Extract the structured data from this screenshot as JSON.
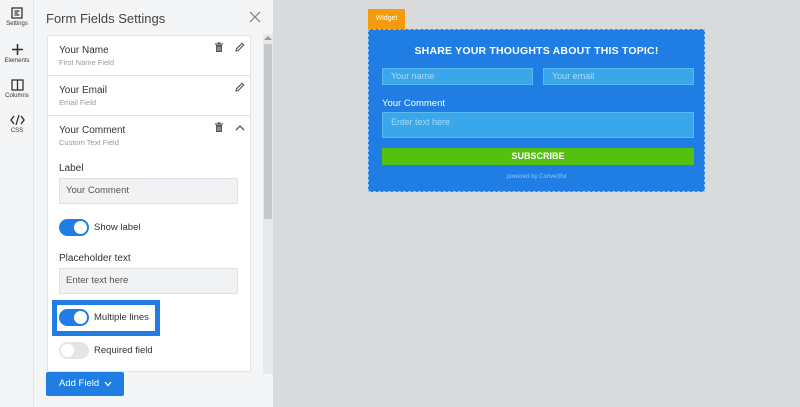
{
  "rail": {
    "settings_label": "Settings",
    "elements_label": "Elements",
    "columns_label": "Columns",
    "css_label": "CSS"
  },
  "panel": {
    "title": "Form Fields Settings",
    "fields": [
      {
        "name": "Your Name",
        "type": "First Name Field"
      },
      {
        "name": "Your Email",
        "type": "Email Field"
      },
      {
        "name": "Your Comment",
        "type": "Custom Text Field"
      }
    ],
    "editor": {
      "label_heading": "Label",
      "label_value": "Your Comment",
      "show_label_text": "Show label",
      "show_label_on": true,
      "placeholder_heading": "Placeholder text",
      "placeholder_value": "Enter text here",
      "multiple_lines_text": "Multiple lines",
      "multiple_lines_on": true,
      "required_text": "Required field",
      "required_on": false
    },
    "add_field_label": "Add Field"
  },
  "widget": {
    "tag": "Widget",
    "title": "SHARE YOUR THOUGHTS ABOUT THIS TOPIC!",
    "name_placeholder": "Your name",
    "email_placeholder": "Your email",
    "comment_label": "Your Comment",
    "comment_placeholder": "Enter text here",
    "button_label": "SUBSCRIBE",
    "powered_by": "powered by Convertful"
  },
  "colors": {
    "accent": "#1f7de3",
    "button_green": "#55c012",
    "tag_orange": "#f59a0d"
  }
}
